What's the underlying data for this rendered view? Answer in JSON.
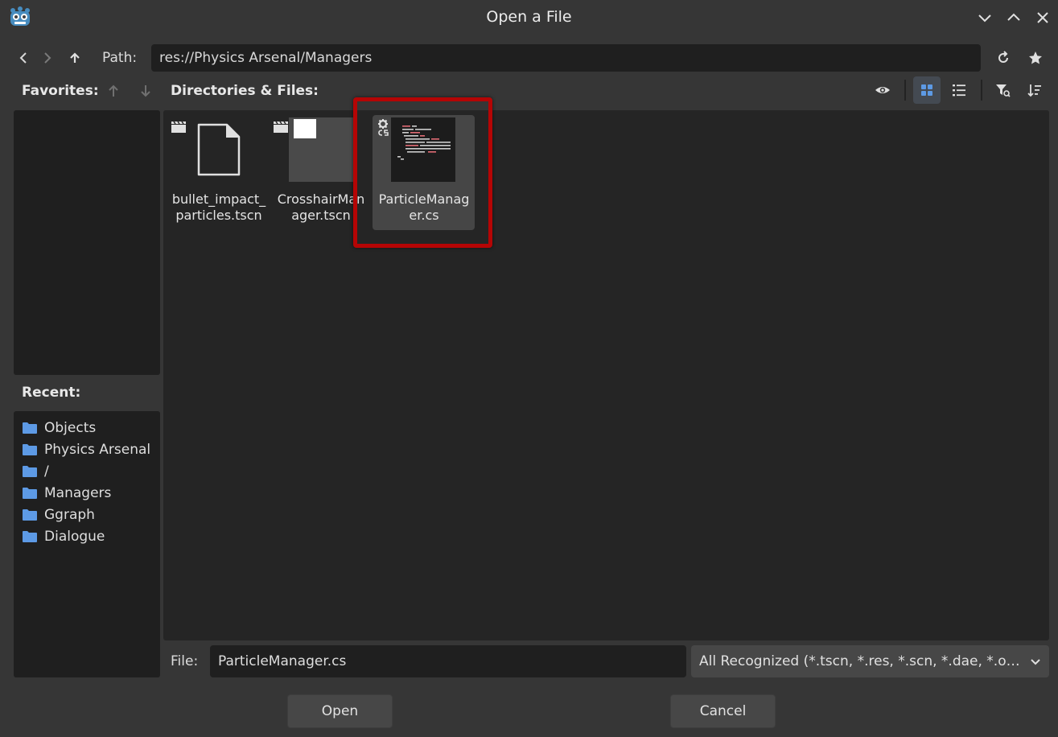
{
  "window": {
    "title": "Open a File",
    "app_icon": "godot-logo-icon"
  },
  "nav": {
    "path_label": "Path:",
    "path_value": "res://Physics Arsenal/Managers"
  },
  "favorites": {
    "label": "Favorites:"
  },
  "files": {
    "label": "Directories & Files:",
    "items": [
      {
        "name": "bullet_impact_\nparticles.tscn",
        "icon": "scene-clapper-icon",
        "thumb": "generic-file-icon"
      },
      {
        "name": "CrosshairMan\nager.tscn",
        "icon": "scene-clapper-icon",
        "thumb": "scene-preview"
      },
      {
        "name": "ParticleManag\ner.cs",
        "icon": "csharp-script-icon",
        "thumb": "code-preview",
        "selected": true
      }
    ]
  },
  "recent": {
    "label": "Recent:",
    "items": [
      "Objects",
      "Physics Arsenal",
      "/",
      "Managers",
      "Ggraph",
      "Dialogue"
    ]
  },
  "footer": {
    "file_label": "File:",
    "file_value": "ParticleManager.cs",
    "filter_value": "All Recognized (*.tscn, *.res, *.scn, *.dae, *.obj, *.gltf, *.glb, *.cs)",
    "open_label": "Open",
    "cancel_label": "Cancel"
  },
  "colors": {
    "background": "#363636",
    "panel": "#1f1f1f",
    "accent": "#5d9ae5",
    "highlight": "#b50505"
  }
}
